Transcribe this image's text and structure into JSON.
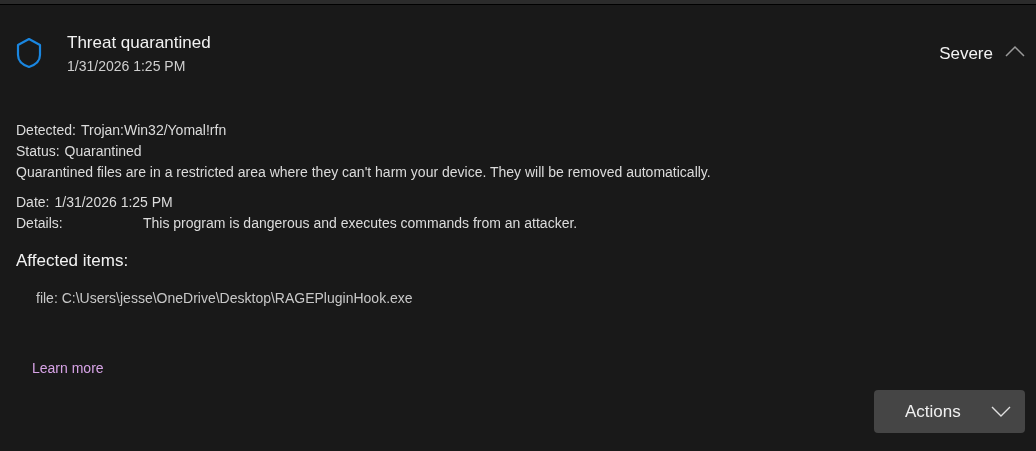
{
  "threat": {
    "title": "Threat quarantined",
    "timestamp": "1/31/2026 1:25 PM",
    "severity": "Severe",
    "expanded": true
  },
  "details": {
    "detected_label": "Detected:",
    "detected_value": "Trojan:Win32/Yomal!rfn",
    "status_label": "Status:",
    "status_value": "Quarantined",
    "note": "Quarantined files are in a restricted area where they can't harm your device. They will be removed automatically.",
    "date_label": "Date:",
    "date_value": "1/31/2026 1:25 PM",
    "details_label": "Details:",
    "details_value": "This program is dangerous and executes commands from an attacker."
  },
  "affected": {
    "heading": "Affected items:",
    "items": [
      "file: C:\\Users\\jesse\\OneDrive\\Desktop\\RAGEPluginHook.exe"
    ]
  },
  "learn_more": "Learn more",
  "actions_button": "Actions"
}
